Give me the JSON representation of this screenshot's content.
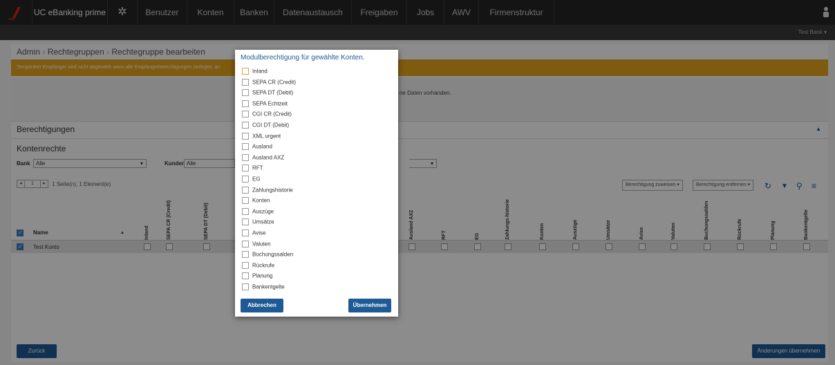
{
  "topnav": {
    "app_title": "UC eBanking prime",
    "items": [
      "Benutzer",
      "Konten",
      "Banken",
      "Datenaustausch",
      "Freigaben",
      "Jobs",
      "AWV",
      "Firmenstruktur"
    ]
  },
  "subbar": {
    "bank": "Test Bank ▾"
  },
  "breadcrumb": [
    "Admin",
    "Rechtegruppen",
    "Rechtegruppe bearbeiten"
  ],
  "warning": "Temporärer Empfänger wird nicht abgewählt wenn alle Empfängerberechtigungen (anlegen, än",
  "nodata": "ne Daten vorhanden.",
  "sections": {
    "berechtigungen": "Berechtigungen",
    "kontenrechte": "Kontenrechte"
  },
  "filters": {
    "bank_label": "Bank",
    "bank_value": "Alle",
    "kunden_label": "Kunden-ID",
    "kunden_value": "Alle"
  },
  "pager": {
    "page": "1",
    "summary": "1 Seite(n), 1 Element(e)"
  },
  "toolbar": {
    "assign": "Berechtigung zuweisen ▾",
    "remove": "Berechtigung entfernen ▾"
  },
  "table": {
    "name_header": "Name",
    "columns": [
      "Inland",
      "SEPA CR (Credit)",
      "SEPA DT (Debit)",
      "Ausland AXZ",
      "RFT",
      "EG",
      "Zahlungs-historie",
      "Konten",
      "Auszüge",
      "Umsätze",
      "Avise",
      "Valuten",
      "Buchungssalden",
      "Rückrufe",
      "Planung",
      "Bankentgelte"
    ],
    "rows": [
      {
        "name": "Test Konto"
      }
    ]
  },
  "buttons": {
    "back": "Zurück",
    "apply_changes": "Änderungen übernehmen"
  },
  "modal": {
    "title": "Modulberechtigung für gewählte Konten.",
    "options": [
      "Inland",
      "SEPA CR (Credit)",
      "SEPA DT (Debit)",
      "SEPA Echtzeit",
      "CGI CR (Credit)",
      "CGI DT (Debit)",
      "XML urgent",
      "Ausland",
      "Ausland AXZ",
      "RFT",
      "EG",
      "Zahlungshistorie",
      "Konten",
      "Auszüge",
      "Umsätze",
      "Avise",
      "Valuten",
      "Buchungssalden",
      "Rückrufe",
      "Planung",
      "Bankentgelte"
    ],
    "cancel": "Abbrechen",
    "apply": "Übernehmen"
  },
  "colors": {
    "accent": "#1e5a96",
    "warning": "#e8a71c",
    "nav": "#262626"
  }
}
